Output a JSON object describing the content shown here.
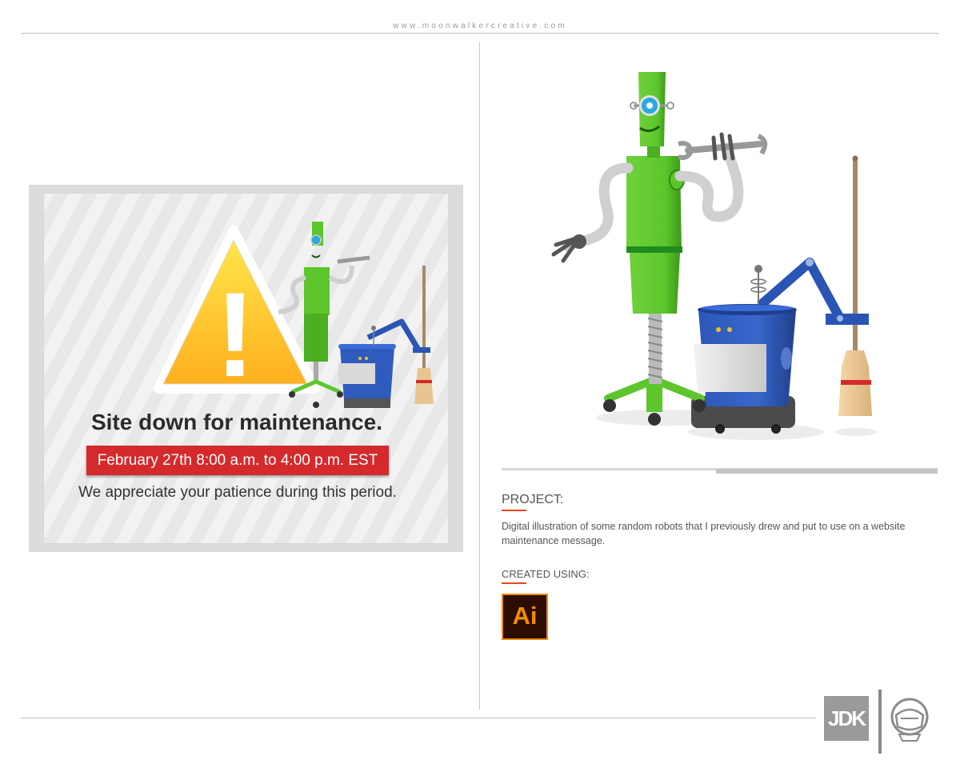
{
  "header": {
    "site_url": "www.moonwalkercreative.com"
  },
  "maintenance_card": {
    "title": "Site down for maintenance.",
    "date_banner": "February 27th 8:00 a.m. to 4:00 p.m. EST",
    "message": "We appreciate your patience during this period.",
    "warning_glyph": "!"
  },
  "project": {
    "label": "PROJECT:",
    "description": "Digital illustration of some random robots that I previously drew and put to use on a website maintenance message."
  },
  "created_using": {
    "label": "CREATED USING:",
    "app_badge": "Ai"
  },
  "footer": {
    "logo_text": "JDK"
  },
  "colors": {
    "accent_orange": "#e8461c",
    "banner_red": "#d42a2c",
    "robot_green": "#5cc62c",
    "robot_blue": "#2a55b4",
    "warning_yellow": "#ffcc1a"
  }
}
